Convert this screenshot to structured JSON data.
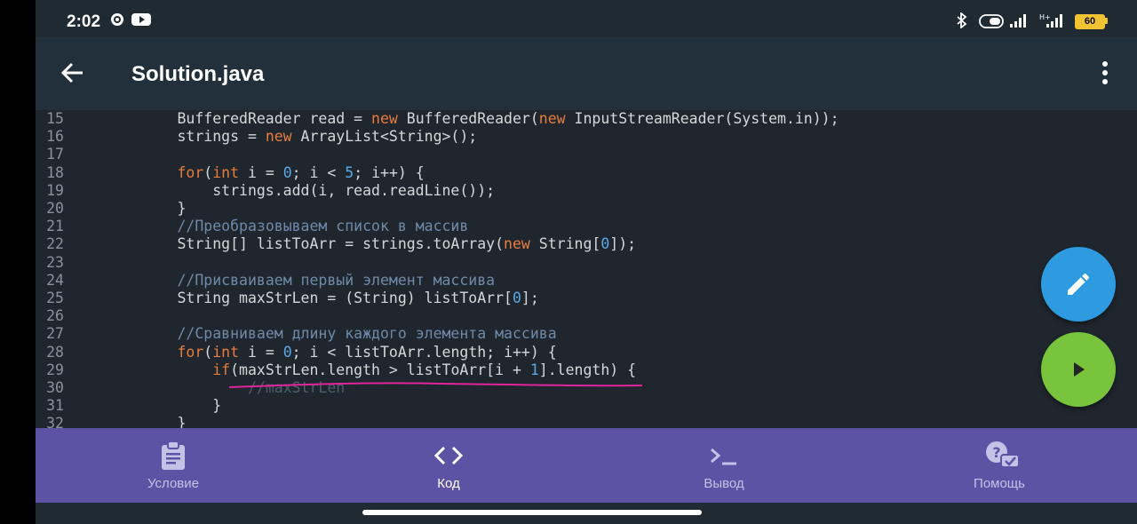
{
  "status_bar": {
    "time": "2:02",
    "battery": "60"
  },
  "app_bar": {
    "title": "Solution.java",
    "back_icon": "arrow-back-icon",
    "menu_icon": "more-vert-icon"
  },
  "editor": {
    "lines": [
      {
        "n": "15",
        "html": "        BufferedReader read = <span class=\"kw\">new</span> BufferedReader(<span class=\"kw\">new</span> InputStreamReader(System.in));"
      },
      {
        "n": "16",
        "html": "        strings = <span class=\"kw\">new</span> ArrayList&lt;String&gt;();"
      },
      {
        "n": "17",
        "html": ""
      },
      {
        "n": "18",
        "html": "        <span class=\"kw\">for</span>(<span class=\"kw\">int</span> i = <span class=\"num\">0</span>; i &lt; <span class=\"num\">5</span>; i++) {"
      },
      {
        "n": "19",
        "html": "            strings.add(i, read.readLine());"
      },
      {
        "n": "20",
        "html": "        }"
      },
      {
        "n": "21",
        "html": "        <span class=\"cm\">//Преобразовываем список в массив</span>"
      },
      {
        "n": "22",
        "html": "        String[] listToArr = strings.toArray(<span class=\"kw\">new</span> String[<span class=\"num\">0</span>]);"
      },
      {
        "n": "23",
        "html": ""
      },
      {
        "n": "24",
        "html": "        <span class=\"cm\">//Присваиваем первый элемент массива</span>"
      },
      {
        "n": "25",
        "html": "        String maxStrLen = (String) listToArr[<span class=\"num\">0</span>];"
      },
      {
        "n": "26",
        "html": ""
      },
      {
        "n": "27",
        "html": "        <span class=\"cm\">//Сравниваем длину каждого элемента массива</span>"
      },
      {
        "n": "28",
        "html": "        <span class=\"kw\">for</span>(<span class=\"kw\">int</span> i = <span class=\"num\">0</span>; i &lt; listToArr.length; i++) {"
      },
      {
        "n": "29",
        "html": "            <span class=\"kw\">if</span>(maxStrLen.length &gt; listToArr[i + <span class=\"num\">1</span>].length) {"
      },
      {
        "n": "30",
        "html": "                <span class=\"cm-faded\">//maxStrLen</span>"
      },
      {
        "n": "31",
        "html": "            }"
      },
      {
        "n": "32",
        "html": "        }"
      }
    ]
  },
  "fabs": {
    "edit_icon": "pencil-icon",
    "run_icon": "play-icon"
  },
  "bottom_nav": {
    "items": [
      {
        "label": "Условие",
        "icon": "clipboard-icon"
      },
      {
        "label": "Код",
        "icon": "code-icon"
      },
      {
        "label": "Вывод",
        "icon": "terminal-icon"
      },
      {
        "label": "Помощь",
        "icon": "help-chat-icon"
      }
    ],
    "active": "Код"
  },
  "colors": {
    "keyword": "#e87d3e",
    "number": "#5aa9e6",
    "comment": "#6f8aa8",
    "nav_bg": "#5c53a5",
    "fab_edit": "#2e9be0",
    "fab_run": "#78c43c",
    "annotation_underline": "#e0249c"
  }
}
